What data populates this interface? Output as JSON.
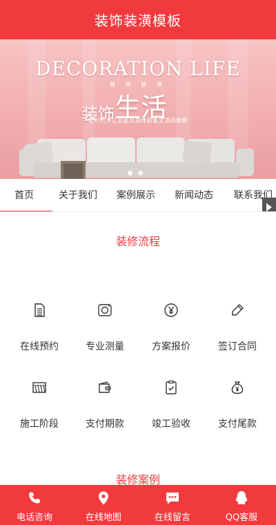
{
  "header": {
    "title": "装饰装潢模板"
  },
  "banner": {
    "headline": "DECORATION LIFE",
    "small_text": "装 饰 装 潢",
    "big_text_a": "装饰",
    "big_text_b": "生活",
    "slogan": "我们努力让您能时刻体验着生活的精致"
  },
  "nav": {
    "tabs": [
      "首页",
      "关于我们",
      "案例展示",
      "新闻动态",
      "联系我们"
    ]
  },
  "process": {
    "title": "装修流程",
    "steps": [
      {
        "label": "在线预约",
        "icon": "document-icon"
      },
      {
        "label": "专业测量",
        "icon": "tape-measure-icon"
      },
      {
        "label": "方案报价",
        "icon": "yuan-icon"
      },
      {
        "label": "签订合同",
        "icon": "pencil-icon"
      },
      {
        "label": "施工阶段",
        "icon": "construction-icon"
      },
      {
        "label": "支付期款",
        "icon": "wallet-icon"
      },
      {
        "label": "竣工验收",
        "icon": "clipboard-check-icon"
      },
      {
        "label": "支付尾款",
        "icon": "money-bag-icon"
      }
    ]
  },
  "cases": {
    "title": "装修案例"
  },
  "bottom_bar": {
    "items": [
      {
        "label": "电话咨询",
        "icon": "phone-icon"
      },
      {
        "label": "在线地图",
        "icon": "map-pin-icon"
      },
      {
        "label": "在线留言",
        "icon": "message-icon"
      },
      {
        "label": "QQ客服",
        "icon": "qq-icon"
      }
    ]
  },
  "colors": {
    "accent": "#f13a3d",
    "banner": "#f2aeb0"
  }
}
